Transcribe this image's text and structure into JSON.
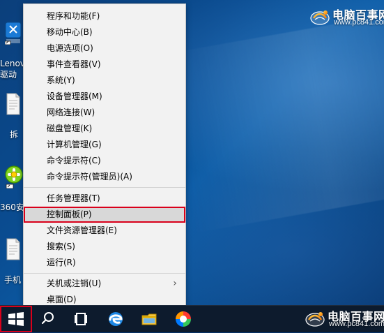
{
  "watermark": {
    "brand": "电脑百事网",
    "url": "www.pc841.com"
  },
  "desktop": {
    "icons": [
      {
        "label_line1": "Lenovo",
        "label_line2": "驱动"
      },
      {
        "label_line1": "拆"
      },
      {
        "label_line1": "360安"
      },
      {
        "label_line1": "手机"
      }
    ]
  },
  "context_menu": {
    "items": [
      {
        "label": "程序和功能(F)"
      },
      {
        "label": "移动中心(B)"
      },
      {
        "label": "电源选项(O)"
      },
      {
        "label": "事件查看器(V)"
      },
      {
        "label": "系统(Y)"
      },
      {
        "label": "设备管理器(M)"
      },
      {
        "label": "网络连接(W)"
      },
      {
        "label": "磁盘管理(K)"
      },
      {
        "label": "计算机管理(G)"
      },
      {
        "label": "命令提示符(C)"
      },
      {
        "label": "命令提示符(管理员)(A)"
      },
      {
        "label": "任务管理器(T)"
      },
      {
        "label": "控制面板(P)"
      },
      {
        "label": "文件资源管理器(E)"
      },
      {
        "label": "搜索(S)"
      },
      {
        "label": "运行(R)"
      },
      {
        "label": "关机或注销(U)"
      },
      {
        "label": "桌面(D)"
      }
    ],
    "submenu_arrow_glyph": "›",
    "highlight_color": "#d9001b"
  },
  "taskbar": {
    "icons": [
      {
        "name": "windows-start-icon"
      },
      {
        "name": "search-icon"
      },
      {
        "name": "task-view-icon"
      },
      {
        "name": "edge-icon"
      },
      {
        "name": "file-explorer-icon"
      },
      {
        "name": "app-color-icon"
      }
    ]
  }
}
